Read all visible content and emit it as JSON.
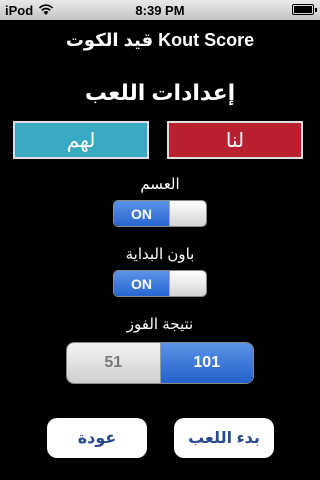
{
  "status_bar": {
    "carrier": "iPod",
    "time": "8:39 PM"
  },
  "app": {
    "title": "قيد الكوت Kout Score"
  },
  "settings": {
    "heading": "إعدادات اللعب",
    "teams": {
      "them": "لهم",
      "us": "لنا"
    },
    "switches": [
      {
        "label": "العسم",
        "state": "ON"
      },
      {
        "label": "باون البداية",
        "state": "ON"
      }
    ],
    "win_score": {
      "label": "نتيجة الفوز",
      "options": [
        "51",
        "101"
      ],
      "selected": "101"
    }
  },
  "buttons": {
    "back": "عودة",
    "start": "بدء اللعب"
  },
  "colors": {
    "us": "#b92030",
    "them": "#3aa9c4",
    "accent": "#2866d1"
  }
}
